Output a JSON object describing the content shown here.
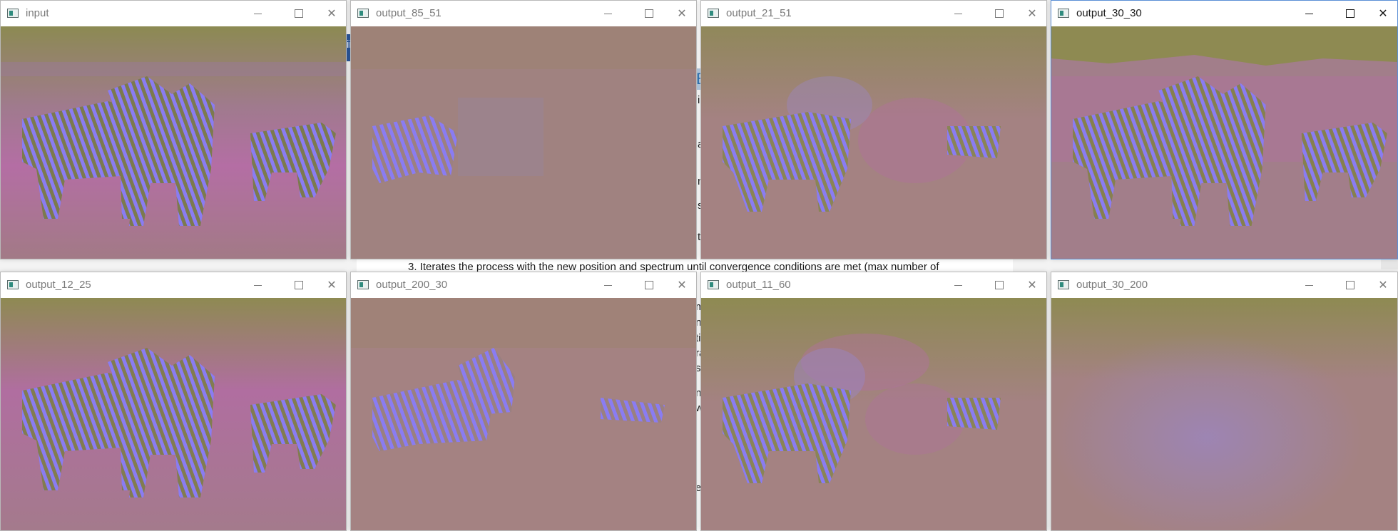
{
  "document": {
    "list_item_line": "3.   Iterates the process with the new position and spectrum until convergence conditions are met (max number of",
    "fragments": [
      "na",
      "s",
      "ti",
      "m",
      "n",
      "ti",
      "ra",
      "st",
      "nt",
      "w",
      "e",
      "i",
      "a",
      "ii",
      "B"
    ]
  },
  "windows": [
    {
      "title": "input"
    },
    {
      "title": "output_85_51"
    },
    {
      "title": "output_21_51"
    },
    {
      "title": "output_30_30"
    },
    {
      "title": "output_12_25"
    },
    {
      "title": "output_200_30"
    },
    {
      "title": "output_11_60"
    },
    {
      "title": "output_30_200"
    }
  ],
  "colors": {
    "zebra_stripe": "#8a7cf2",
    "olive": "#8e8a52",
    "muted_rose": "#a48282",
    "pink": "#b46ea4",
    "lavender_haze": "#9a86c8"
  },
  "icons": {
    "app": "opencv-window-icon",
    "minimize": "minimize-icon",
    "maximize": "maximize-icon",
    "close": "close-icon"
  }
}
